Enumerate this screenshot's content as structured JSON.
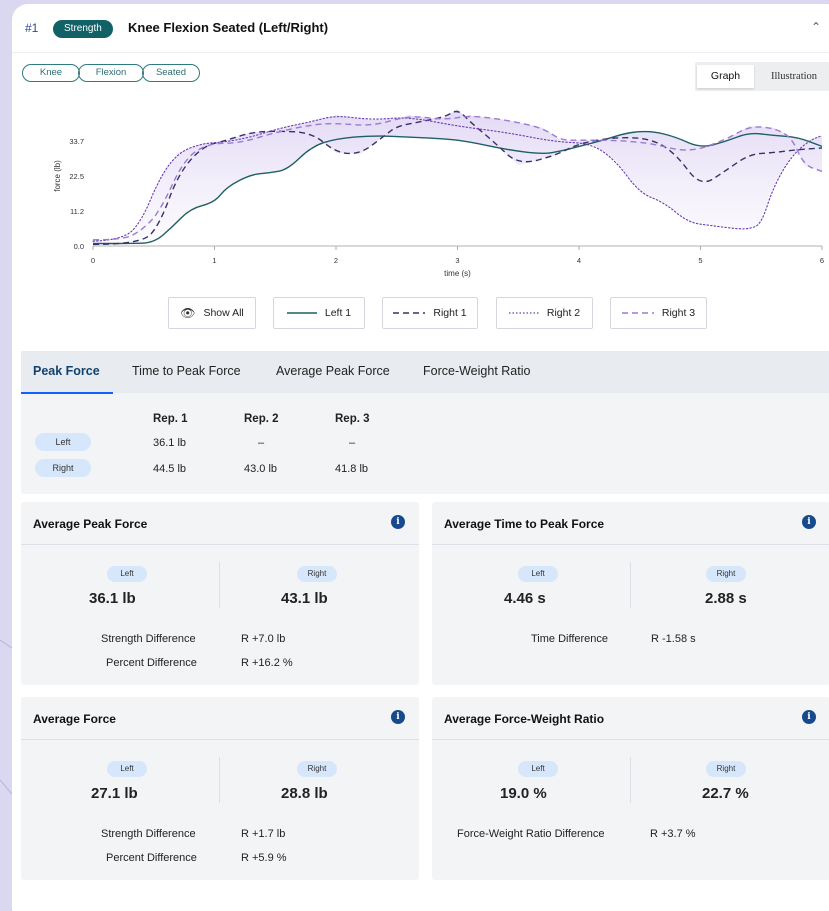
{
  "header": {
    "number": "#1",
    "category": "Strength",
    "title": "Knee Flexion Seated (Left/Right)"
  },
  "tags": [
    "Knee",
    "Flexion",
    "Seated"
  ],
  "view_toggle": {
    "selected": "Graph",
    "other": "Illustration"
  },
  "chart_data": {
    "type": "line",
    "title": "",
    "xlabel": "time (s)",
    "ylabel": "force (lb)",
    "xlim": [
      0,
      6
    ],
    "ylim": [
      0,
      45
    ],
    "x_ticks": [
      "0",
      "1",
      "2",
      "3",
      "4",
      "5",
      "6"
    ],
    "y_ticks": [
      "0.0",
      "11.2",
      "22.5",
      "33.7"
    ],
    "grid": false,
    "shaded_band": true,
    "series": [
      {
        "name": "Left 1",
        "style": "solid",
        "color": "#1f5f66",
        "x": [
          0,
          0.3,
          0.5,
          0.65,
          0.8,
          1.0,
          1.1,
          1.3,
          1.45,
          1.6,
          1.8,
          2.0,
          2.3,
          2.6,
          2.9,
          3.1,
          3.4,
          3.7,
          3.85,
          4.0,
          4.2,
          4.4,
          4.6,
          4.8,
          5.0,
          5.2,
          5.4,
          5.6,
          5.8,
          6.0
        ],
        "y": [
          0.8,
          0.8,
          1.0,
          6,
          12,
          14,
          19,
          23,
          23.5,
          24.5,
          32,
          34.5,
          35.5,
          35,
          34.5,
          33.5,
          31,
          29.5,
          30.5,
          32,
          34,
          36.5,
          37,
          35,
          31.5,
          33.5,
          36.5,
          35.5,
          35,
          32
        ]
      },
      {
        "name": "Right 1",
        "style": "dashed",
        "color": "#3a3168",
        "x": [
          0,
          0.4,
          0.55,
          0.7,
          0.9,
          1.1,
          1.3,
          1.5,
          1.8,
          2.0,
          2.2,
          2.4,
          2.5,
          2.7,
          2.9,
          3.0,
          3.1,
          3.3,
          3.5,
          3.8,
          4.0,
          4.3,
          4.6,
          4.8,
          5.0,
          5.2,
          5.4,
          5.6,
          5.8,
          6.0
        ],
        "y": [
          0.5,
          0.5,
          7,
          23,
          32,
          34,
          36.5,
          37,
          36.5,
          30,
          29.5,
          35.5,
          38.5,
          40,
          41.5,
          44,
          40,
          33.5,
          26,
          29,
          33,
          35,
          34.5,
          29.5,
          19,
          24,
          29.5,
          30,
          31,
          31.5
        ]
      },
      {
        "name": "Right 2",
        "style": "dotted",
        "color": "#6a3ab0",
        "x": [
          0,
          0.25,
          0.4,
          0.55,
          0.7,
          0.9,
          1.1,
          1.3,
          1.55,
          1.8,
          2.0,
          2.3,
          2.6,
          3.0,
          3.4,
          3.8,
          4.1,
          4.3,
          4.5,
          4.7,
          4.9,
          5.1,
          5.3,
          5.4,
          5.5,
          5.6,
          5.75,
          5.9,
          6.0
        ],
        "y": [
          1.5,
          2,
          8,
          22,
          30,
          33,
          33.5,
          35,
          38,
          40,
          42,
          40.5,
          41.5,
          38.5,
          36.5,
          33.5,
          33,
          27.5,
          17,
          14,
          7.5,
          6.5,
          5.5,
          5.5,
          7,
          19,
          29,
          34,
          35.5
        ]
      },
      {
        "name": "Right 3",
        "style": "dashed",
        "color": "#9b7ad0",
        "x": [
          0,
          0.25,
          0.4,
          0.55,
          0.75,
          0.95,
          1.2,
          1.5,
          1.8,
          2.0,
          2.3,
          2.6,
          2.9,
          3.1,
          3.4,
          3.7,
          3.85,
          4.0,
          4.3,
          4.6,
          4.9,
          5.2,
          5.4,
          5.6,
          5.75,
          5.85,
          6.0
        ],
        "y": [
          2,
          2,
          5,
          11,
          28,
          33,
          33,
          36.5,
          39,
          39.5,
          38.5,
          42,
          40.5,
          42,
          40.5,
          38,
          34,
          34,
          34,
          33,
          30,
          34,
          38.5,
          38,
          35,
          26,
          24
        ]
      }
    ],
    "legend": [
      "Show All",
      "Left 1",
      "Right 1",
      "Right 2",
      "Right 3"
    ]
  },
  "metric_tabs": [
    "Peak Force",
    "Time to Peak Force",
    "Average Peak Force",
    "Force-Weight Ratio"
  ],
  "rep_table": {
    "columns": [
      "Rep. 1",
      "Rep. 2",
      "Rep. 3"
    ],
    "rows": [
      {
        "side": "Left",
        "values": [
          "36.1 lb",
          "–",
          "–"
        ]
      },
      {
        "side": "Right",
        "values": [
          "44.5 lb",
          "43.0 lb",
          "41.8 lb"
        ]
      }
    ]
  },
  "panels": {
    "avg_peak_force": {
      "title": "Average Peak Force",
      "left_label": "Left",
      "left_value": "36.1 lb",
      "right_label": "Right",
      "right_value": "43.1 lb",
      "rows": [
        {
          "label": "Strength Difference",
          "value": "R +7.0 lb"
        },
        {
          "label": "Percent Difference",
          "value": "R +16.2 %"
        }
      ]
    },
    "avg_time_to_peak": {
      "title": "Average Time to Peak Force",
      "left_label": "Left",
      "left_value": "4.46 s",
      "right_label": "Right",
      "right_value": "2.88 s",
      "rows": [
        {
          "label": "Time Difference",
          "value": "R -1.58 s"
        }
      ]
    },
    "avg_force": {
      "title": "Average Force",
      "left_label": "Left",
      "left_value": "27.1 lb",
      "right_label": "Right",
      "right_value": "28.8 lb",
      "rows": [
        {
          "label": "Strength Difference",
          "value": "R +1.7 lb"
        },
        {
          "label": "Percent Difference",
          "value": "R +5.9 %"
        }
      ]
    },
    "avg_fw_ratio": {
      "title": "Average Force-Weight Ratio",
      "left_label": "Left",
      "left_value": "19.0 %",
      "right_label": "Right",
      "right_value": "22.7 %",
      "rows": [
        {
          "label": "Force-Weight Ratio Difference",
          "value": "R +3.7 %"
        }
      ]
    }
  },
  "colors": {
    "accent": "#116166",
    "info_icon": "#174a8c",
    "tab_active": "#12426e",
    "chip_bg": "#d7e7fb"
  }
}
